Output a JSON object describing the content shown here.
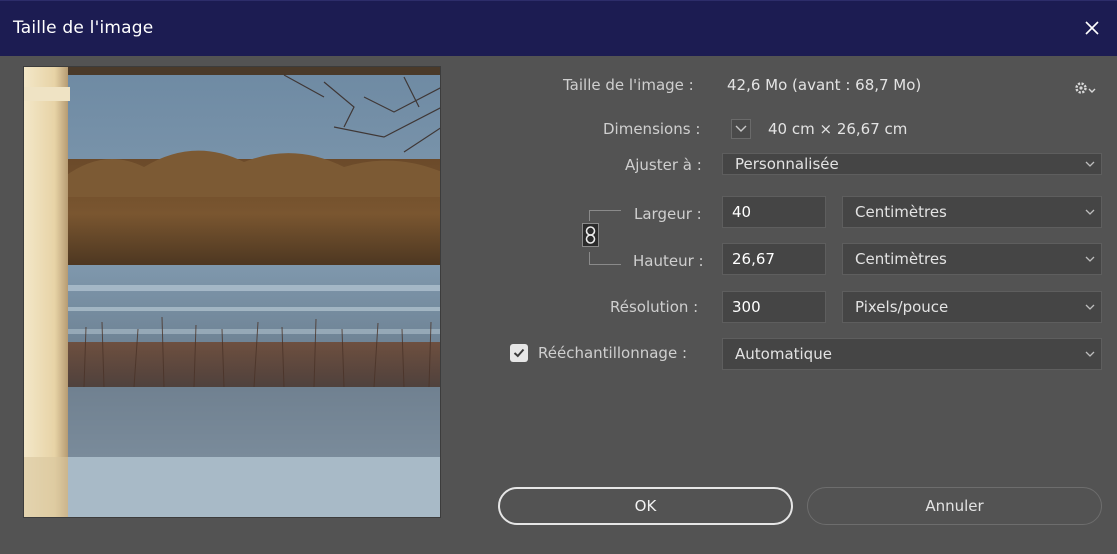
{
  "window": {
    "title": "Taille de l'image",
    "close_icon": "close-icon"
  },
  "preview": {
    "icon": "image-preview"
  },
  "info": {
    "size_label": "Taille de l'image :",
    "size_value": "42,6 Mo (avant : 68,7 Mo)",
    "settings_icon": "gear-icon",
    "dimensions_label": "Dimensions :",
    "dimensions_value": "40 cm  ×  26,67 cm"
  },
  "fit": {
    "label": "Ajuster à :",
    "value": "Personnalisée"
  },
  "width": {
    "label": "Largeur :",
    "value": "40",
    "unit": "Centimètres"
  },
  "height": {
    "label": "Hauteur :",
    "value": "26,67",
    "unit": "Centimètres"
  },
  "resolution": {
    "label": "Résolution :",
    "value": "300",
    "unit": "Pixels/pouce"
  },
  "resample": {
    "label": "Rééchantillonnage :",
    "checked": true,
    "value": "Automatique"
  },
  "buttons": {
    "ok": "OK",
    "cancel": "Annuler"
  },
  "colors": {
    "titlebar": "#1c1c52",
    "panel": "#535353",
    "field": "#454545"
  }
}
